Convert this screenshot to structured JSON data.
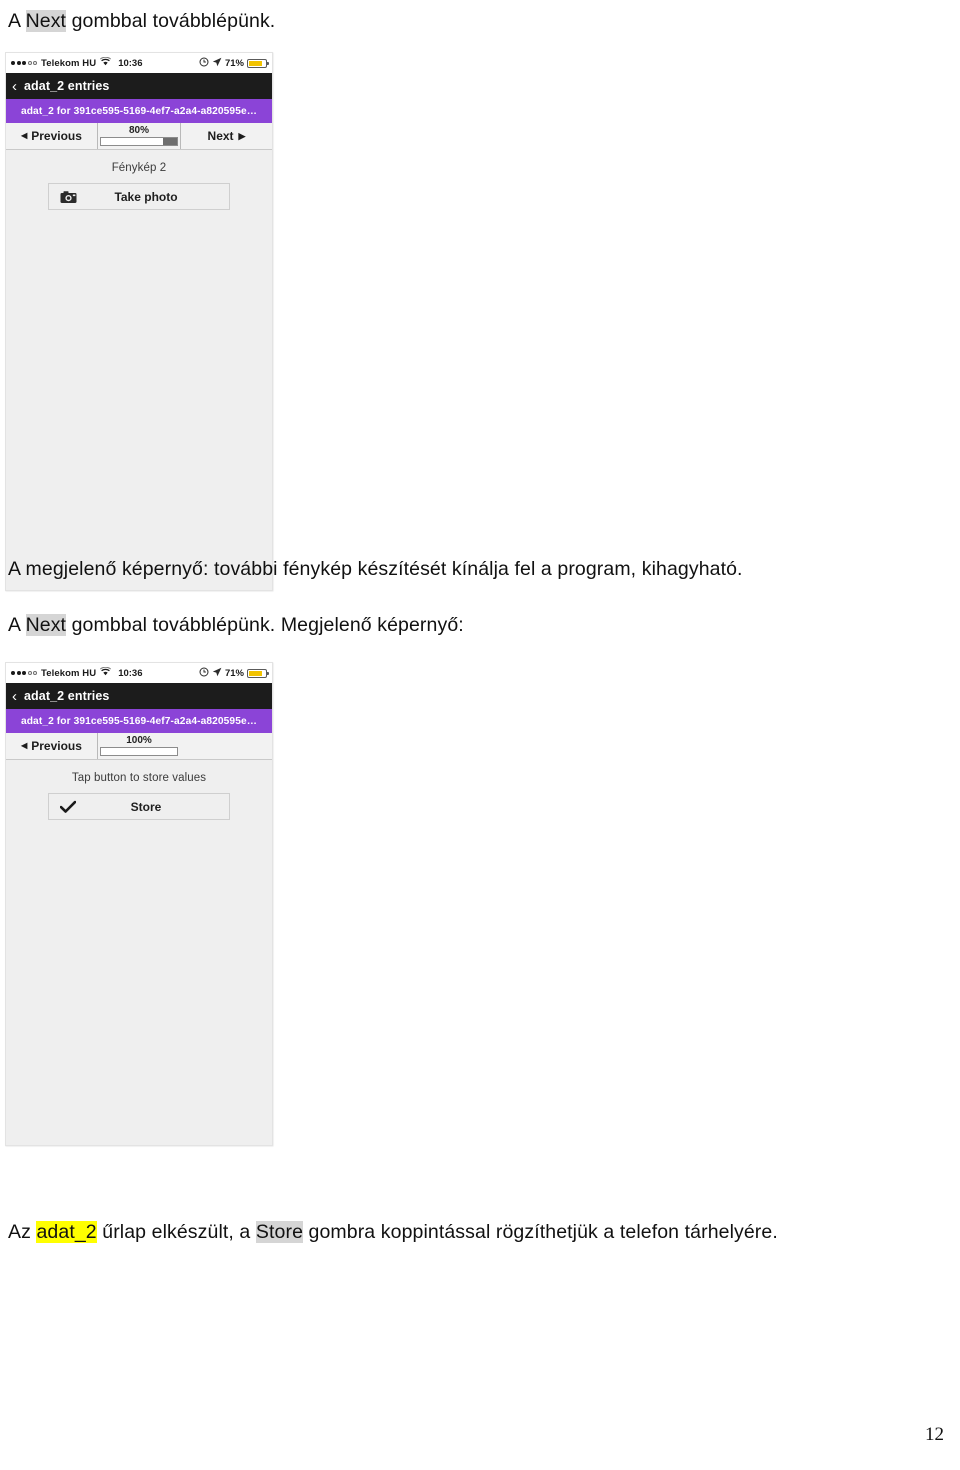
{
  "document": {
    "paragraphs": [
      {
        "id": "p1",
        "prefix": "A ",
        "highlight": "Next",
        "highlight_color": "gray",
        "suffix": " gombbal továbblépünk."
      },
      {
        "id": "p2",
        "text": "A megjelenő képernyő: további fénykép készítését kínálja fel a program, kihagyható."
      },
      {
        "id": "p3",
        "prefix": "A ",
        "highlight": "Next",
        "highlight_color": "gray",
        "suffix": " gombbal továbblépünk. Megjelenő képernyő:"
      },
      {
        "id": "p4",
        "prefix": "Az ",
        "highlight": "adat_2",
        "highlight_color": "yellow",
        "middle": " űrlap elkészült, a ",
        "highlight2": "Store",
        "highlight2_color": "gray",
        "suffix": " gombra koppintással rögzíthetjük a telefon tárhelyére."
      }
    ],
    "page_number": "12"
  },
  "screenshot_1": {
    "status_bar": {
      "carrier": "Telekom HU",
      "signal_filled": 3,
      "signal_hollow": 2,
      "wifi_icon": "wifi-icon",
      "time": "10:36",
      "alarm_icon": "alarm-clock-icon",
      "location_icon": "location-arrow-icon",
      "battery_percent": "71%",
      "battery_color": "#f2c300"
    },
    "nav_bar": {
      "back_icon": "chevron-left-icon",
      "title": "adat_2 entries"
    },
    "banner": {
      "text": "adat_2 for 391ce595-5169-4ef7-a2a4-a820595e…",
      "color": "#8b44d7"
    },
    "toolbar": {
      "previous_label": "Previous",
      "previous_icon": "triangle-left-icon",
      "progress_percent": "80%",
      "progress_value": 80,
      "next_label": "Next",
      "next_icon": "triangle-right-icon",
      "has_next": true
    },
    "body": {
      "field_label": "Fénykép 2",
      "button_label": "Take photo",
      "button_icon": "camera-icon"
    }
  },
  "screenshot_2": {
    "status_bar": {
      "carrier": "Telekom HU",
      "signal_filled": 3,
      "signal_hollow": 2,
      "wifi_icon": "wifi-icon",
      "time": "10:36",
      "alarm_icon": "alarm-clock-icon",
      "location_icon": "location-arrow-icon",
      "battery_percent": "71%",
      "battery_color": "#f2c300"
    },
    "nav_bar": {
      "back_icon": "chevron-left-icon",
      "title": "adat_2 entries"
    },
    "banner": {
      "text": "adat_2 for 391ce595-5169-4ef7-a2a4-a820595e…",
      "color": "#8b44d7"
    },
    "toolbar": {
      "previous_label": "Previous",
      "previous_icon": "triangle-left-icon",
      "progress_percent": "100%",
      "progress_value": 100,
      "next_label": "",
      "has_next": false
    },
    "body": {
      "field_label": "Tap button to store values",
      "button_label": "Store",
      "button_icon": "checkmark-icon"
    }
  }
}
